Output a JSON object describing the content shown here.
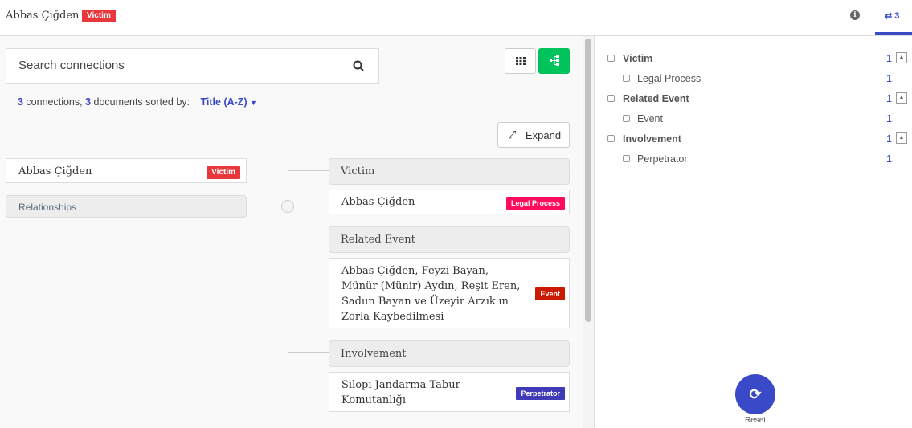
{
  "header": {
    "title": "Abbas Çiğden",
    "badge": "Victim",
    "badge_color": "#e8383d",
    "connections_tab_count": "3"
  },
  "search": {
    "placeholder": "Search connections"
  },
  "summary": {
    "connections": "3",
    "connections_label": " connections, ",
    "documents": "3",
    "documents_label": " documents sorted by:",
    "sort": "Title (A-Z)"
  },
  "toolbar": {
    "expand_label": "Expand"
  },
  "reference": {
    "title": "Abbas Çiğden",
    "badge": "Victim",
    "badge_color": "#e8383d",
    "relationships_label": "Relationships"
  },
  "groups": [
    {
      "label": "Victim",
      "items": [
        {
          "title": "Abbas Çiğden",
          "badge": "Legal Process",
          "badge_color": "#ff0d5c"
        }
      ]
    },
    {
      "label": "Related Event",
      "items": [
        {
          "title": "Abbas Çiğden, Feyzi Bayan, Münür (Münir) Aydın, Reşit Eren, Sadun Bayan ve Üzeyir Arzık'ın Zorla Kaybedilmesi",
          "badge": "Event",
          "badge_color": "#cc1a00"
        }
      ]
    },
    {
      "label": "Involvement",
      "items": [
        {
          "title": "Silopi Jandarma Tabur Komutanlığı",
          "badge": "Perpetrator",
          "badge_color": "#3e3ab8"
        }
      ]
    }
  ],
  "filters": [
    {
      "label": "Victim",
      "count": "1",
      "children": [
        {
          "label": "Legal Process",
          "count": "1"
        }
      ]
    },
    {
      "label": "Related Event",
      "count": "1",
      "children": [
        {
          "label": "Event",
          "count": "1"
        }
      ]
    },
    {
      "label": "Involvement",
      "count": "1",
      "children": [
        {
          "label": "Perpetrator",
          "count": "1"
        }
      ]
    }
  ],
  "reset_label": "Reset",
  "accent_color": "#3949c7"
}
